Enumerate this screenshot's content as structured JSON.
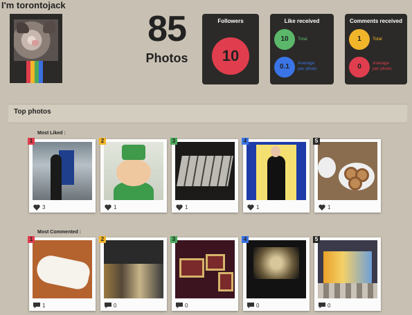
{
  "profile": {
    "username": "I'm torontojack",
    "stripe_colors": [
      "#e03e4e",
      "#f1b52a",
      "#4aa85a",
      "#3a6fe0"
    ]
  },
  "photos": {
    "count": "85",
    "label": "Photos"
  },
  "followers": {
    "title": "Followers",
    "value": "10",
    "color": "#e03e4e"
  },
  "likes": {
    "title": "Like received",
    "total": {
      "value": "10",
      "label": "Total",
      "color": "#5bb86a"
    },
    "average": {
      "value": "0.1",
      "label": "Average\nper photo",
      "color": "#3a74e6"
    }
  },
  "comments": {
    "title": "Comments received",
    "total": {
      "value": "1",
      "label": "Total",
      "color": "#f1b52a"
    },
    "average": {
      "value": "0",
      "label": "Average\nper photo",
      "color": "#e03e4e"
    }
  },
  "top_photos": {
    "title": "Top photos",
    "most_liked": {
      "label": "Most Liked :",
      "items": [
        {
          "rank": "1",
          "rank_color": "#e03e4e",
          "count": "3"
        },
        {
          "rank": "2",
          "rank_color": "#f1b52a",
          "count": "1"
        },
        {
          "rank": "3",
          "rank_color": "#4aa85a",
          "count": "1"
        },
        {
          "rank": "4",
          "rank_color": "#3a74e6",
          "count": "1"
        },
        {
          "rank": "5",
          "rank_color": "#2b2a28",
          "count": "1"
        }
      ]
    },
    "most_commented": {
      "label": "Most Commented :",
      "items": [
        {
          "rank": "1",
          "rank_color": "#e03e4e",
          "count": "1"
        },
        {
          "rank": "2",
          "rank_color": "#f1b52a",
          "count": "0"
        },
        {
          "rank": "3",
          "rank_color": "#4aa85a",
          "count": "0"
        },
        {
          "rank": "4",
          "rank_color": "#3a74e6",
          "count": "0"
        },
        {
          "rank": "5",
          "rank_color": "#2b2a28",
          "count": "0"
        }
      ]
    }
  }
}
